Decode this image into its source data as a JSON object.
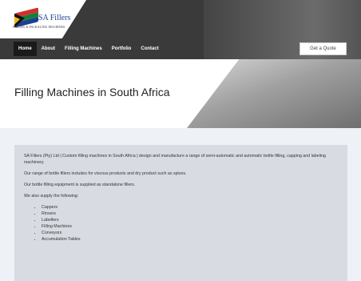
{
  "brand": {
    "name": "SA Fillers",
    "tagline": "FILLING & PACKAGING MACHINES",
    "flag_colors": [
      "#d0312d",
      "#127f3a",
      "#1d3f94",
      "#111111",
      "#f3b81e"
    ]
  },
  "nav": {
    "items": [
      {
        "label": "Home",
        "active": true
      },
      {
        "label": "About",
        "active": false
      },
      {
        "label": "Filling Machines",
        "active": false
      },
      {
        "label": "Portfolio",
        "active": false
      },
      {
        "label": "Contact",
        "active": false
      }
    ],
    "cta_label": "Get a Quote"
  },
  "banner": {
    "title": "Filling Machines in South Africa"
  },
  "content": {
    "paragraphs": [
      "SA Fillers (Pty) Ltd | Custom filling machines in South Africa | design and manufacture a range of semi-automatic and automatic bottle filling, capping and labeling machinery.",
      "Our range of bottle fillers includes for viscous products and dry product such as spices.",
      "Our bottle filling equipment is supplied as standalone fillers.",
      "We also supply the following:"
    ],
    "list": [
      "Cappers",
      "Rinsers",
      "Labellers",
      "Filling Machines",
      "Conveyors",
      "Accumulation Tables"
    ]
  }
}
